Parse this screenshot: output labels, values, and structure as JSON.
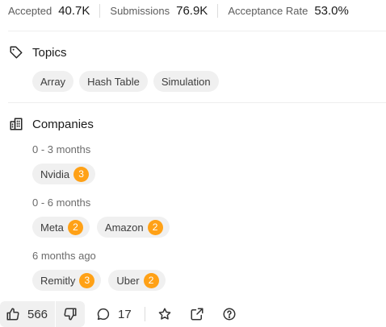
{
  "stats": [
    {
      "label": "Accepted",
      "value": "40.7K"
    },
    {
      "label": "Submissions",
      "value": "76.9K"
    },
    {
      "label": "Acceptance Rate",
      "value": "53.0%"
    }
  ],
  "topics": {
    "title": "Topics",
    "icon": "tag-icon",
    "items": [
      "Array",
      "Hash Table",
      "Simulation"
    ]
  },
  "companies": {
    "title": "Companies",
    "icon": "building-icon",
    "groups": [
      {
        "period": "0 - 3 months",
        "items": [
          {
            "name": "Nvidia",
            "count": "3"
          }
        ]
      },
      {
        "period": "0 - 6 months",
        "items": [
          {
            "name": "Meta",
            "count": "2"
          },
          {
            "name": "Amazon",
            "count": "2"
          }
        ]
      },
      {
        "period": "6 months ago",
        "items": [
          {
            "name": "Remitly",
            "count": "3"
          },
          {
            "name": "Uber",
            "count": "2"
          }
        ]
      }
    ]
  },
  "actions": {
    "likes": "566",
    "comments": "17"
  },
  "colors": {
    "badge": "#ffa116",
    "chip_bg": "#f0f0f0",
    "divider": "#eeeeee"
  }
}
